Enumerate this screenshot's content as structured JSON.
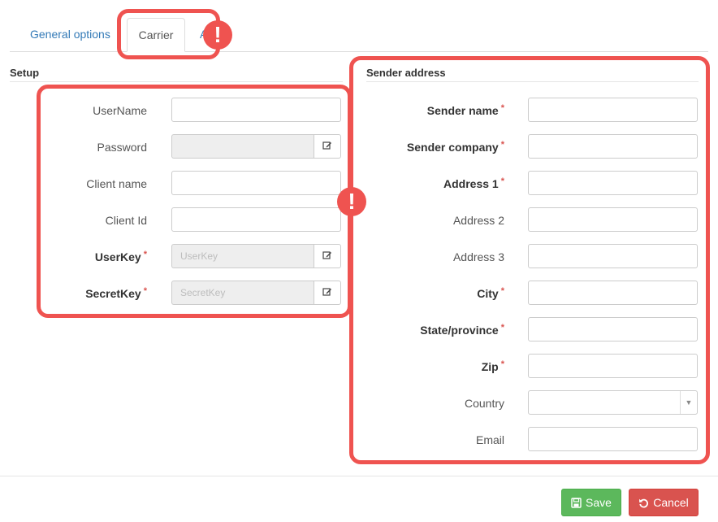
{
  "tabs": {
    "general": "General options",
    "carrier": "Carrier",
    "hidden_fragment": "A"
  },
  "setup": {
    "title": "Setup",
    "fields": [
      {
        "label": "UserName",
        "required": false,
        "value": "",
        "placeholder": ""
      },
      {
        "label": "Password",
        "required": false,
        "value": "",
        "placeholder": ""
      },
      {
        "label": "Client name",
        "required": false,
        "value": "",
        "placeholder": ""
      },
      {
        "label": "Client Id",
        "required": false,
        "value": "",
        "placeholder": ""
      },
      {
        "label": "UserKey",
        "required": true,
        "value": "",
        "placeholder": "UserKey"
      },
      {
        "label": "SecretKey",
        "required": true,
        "value": "",
        "placeholder": "SecretKey"
      }
    ]
  },
  "sender": {
    "title": "Sender address",
    "fields": [
      {
        "label": "Sender name",
        "required": true,
        "value": ""
      },
      {
        "label": "Sender company",
        "required": true,
        "value": ""
      },
      {
        "label": "Address 1",
        "required": true,
        "value": ""
      },
      {
        "label": "Address 2",
        "required": false,
        "value": ""
      },
      {
        "label": "Address 3",
        "required": false,
        "value": ""
      },
      {
        "label": "City",
        "required": true,
        "value": ""
      },
      {
        "label": "State/province",
        "required": true,
        "value": ""
      },
      {
        "label": "Zip",
        "required": true,
        "value": ""
      },
      {
        "label": "Country",
        "required": false,
        "value": ""
      },
      {
        "label": "Email",
        "required": false,
        "value": ""
      }
    ]
  },
  "required_marker": "*",
  "alert_glyph": "!",
  "buttons": {
    "save": "Save",
    "cancel": "Cancel"
  },
  "icons": {
    "edit": "edit-icon",
    "save": "floppy-disk-icon",
    "cancel": "undo-icon",
    "select": "caret-down-icon"
  },
  "colors": {
    "highlight": "#ef5350",
    "save": "#5cb85c",
    "cancel": "#d9534f",
    "link": "#337ab7"
  }
}
